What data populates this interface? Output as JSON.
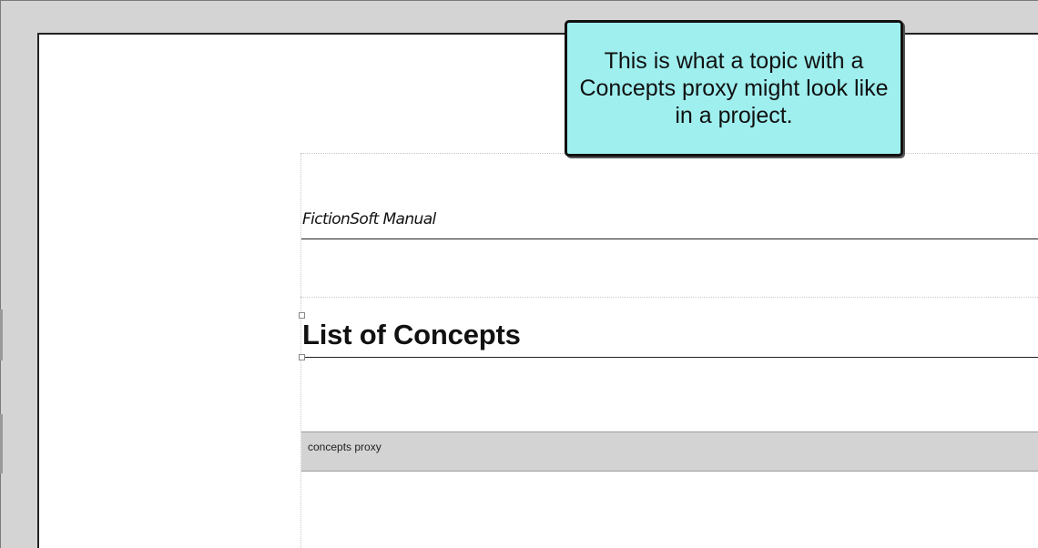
{
  "callout": {
    "text": "This is what a topic with a Concepts proxy might look like in a project."
  },
  "page": {
    "header_text": "FictionSoft Manual",
    "heading": "List of Concepts",
    "proxy_label": "concepts proxy"
  },
  "colors": {
    "callout_fill": "#9fefef",
    "proxy_bar": "#d3d3d3",
    "workspace_background": "#d4d4d4"
  }
}
